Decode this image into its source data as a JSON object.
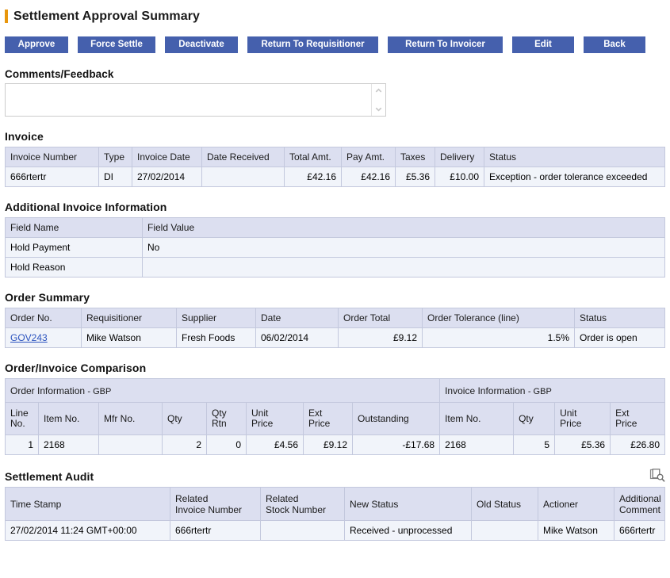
{
  "page": {
    "title": "Settlement Approval Summary",
    "accent_color": "#e8960c",
    "button_color": "#4560ad",
    "money_color": "#2a52be",
    "header_bg": "#dcdff0",
    "row_bg": "#f1f4fa",
    "border_color": "#c3c8dd"
  },
  "toolbar": {
    "buttons": [
      {
        "label": "Approve"
      },
      {
        "label": "Force Settle"
      },
      {
        "label": "Deactivate"
      },
      {
        "label": "Return To Requisitioner"
      },
      {
        "label": "Return To Invoicer"
      },
      {
        "label": "Edit"
      },
      {
        "label": "Back"
      }
    ]
  },
  "comments": {
    "label": "Comments/Feedback",
    "value": "",
    "placeholder": "",
    "scroll_up_icon": "chevron-up-icon",
    "scroll_down_icon": "chevron-down-icon"
  },
  "invoice": {
    "heading": "Invoice",
    "columns": [
      "Invoice Number",
      "Type",
      "Invoice Date",
      "Date Received",
      "Total Amt.",
      "Pay Amt.",
      "Taxes",
      "Delivery",
      "Status"
    ],
    "rows": [
      {
        "invoice_number": "666rtertr",
        "type": "DI",
        "invoice_date": "27/02/2014",
        "date_received": "",
        "total_amt": "£42.16",
        "pay_amt": "£42.16",
        "taxes": "£5.36",
        "delivery": "£10.00",
        "status": "Exception - order tolerance exceeded"
      }
    ]
  },
  "additional_invoice_information": {
    "heading": "Additional Invoice Information",
    "columns": [
      "Field Name",
      "Field Value"
    ],
    "rows": [
      {
        "field_name": "Hold Payment",
        "field_value": "No"
      },
      {
        "field_name": "Hold Reason",
        "field_value": ""
      }
    ]
  },
  "order_summary": {
    "heading": "Order Summary",
    "columns": [
      "Order No.",
      "Requisitioner",
      "Supplier",
      "Date",
      "Order Total",
      "Order Tolerance (line)",
      "Status"
    ],
    "rows": [
      {
        "order_no": "GOV243",
        "requisitioner": "Mike Watson",
        "supplier": "Fresh Foods",
        "date": "06/02/2014",
        "order_total": "£9.12",
        "order_tolerance": "1.5%",
        "status": "Order is open"
      }
    ]
  },
  "order_invoice_comparison": {
    "heading": "Order/Invoice Comparison",
    "group_headers": [
      {
        "main": "Order Information",
        "sub": "- GBP"
      },
      {
        "main": "Invoice Information",
        "sub": "- GBP"
      }
    ],
    "columns": [
      "Line No.",
      "Item No.",
      "Mfr No.",
      "Qty",
      "Qty Rtn",
      "Unit Price",
      "Ext Price",
      "Outstanding",
      "Item No.",
      "Qty",
      "Unit Price",
      "Ext Price"
    ],
    "column_lines": [
      [
        "Line",
        "No."
      ],
      [
        "Item No.",
        ""
      ],
      [
        "Mfr No.",
        ""
      ],
      [
        "Qty",
        ""
      ],
      [
        "Qty",
        "Rtn"
      ],
      [
        "Unit",
        "Price"
      ],
      [
        "Ext",
        "Price"
      ],
      [
        "Outstanding",
        ""
      ],
      [
        "Item No.",
        ""
      ],
      [
        "Qty",
        ""
      ],
      [
        "Unit",
        "Price"
      ],
      [
        "Ext",
        "Price"
      ]
    ],
    "rows": [
      {
        "line_no": "1",
        "order_item_no": "2168",
        "mfr_no": "",
        "order_qty": "2",
        "qty_rtn": "0",
        "order_unit_price": "£4.56",
        "order_ext_price": "£9.12",
        "outstanding": "-£17.68",
        "invoice_item_no": "2168",
        "invoice_qty": "5",
        "invoice_unit_price": "£5.36",
        "invoice_ext_price": "£26.80"
      }
    ]
  },
  "settlement_audit": {
    "heading": "Settlement Audit",
    "view_icon": "document-search-icon",
    "columns": [
      "Time Stamp",
      "Related Invoice Number",
      "Related Stock Number",
      "New Status",
      "Old Status",
      "Actioner",
      "Additional Comment"
    ],
    "column_lines": [
      [
        "Time Stamp",
        ""
      ],
      [
        "Related",
        "Invoice Number"
      ],
      [
        "Related",
        "Stock Number"
      ],
      [
        "New Status",
        ""
      ],
      [
        "Old Status",
        ""
      ],
      [
        "Actioner",
        ""
      ],
      [
        "Additional",
        "Comment"
      ]
    ],
    "rows": [
      {
        "time_stamp": "27/02/2014 11:24 GMT+00:00",
        "related_invoice_number": "666rtertr",
        "related_stock_number": "",
        "new_status": "Received - unprocessed",
        "old_status": "",
        "actioner": "Mike Watson",
        "additional_comment": "666rtertr"
      }
    ]
  }
}
